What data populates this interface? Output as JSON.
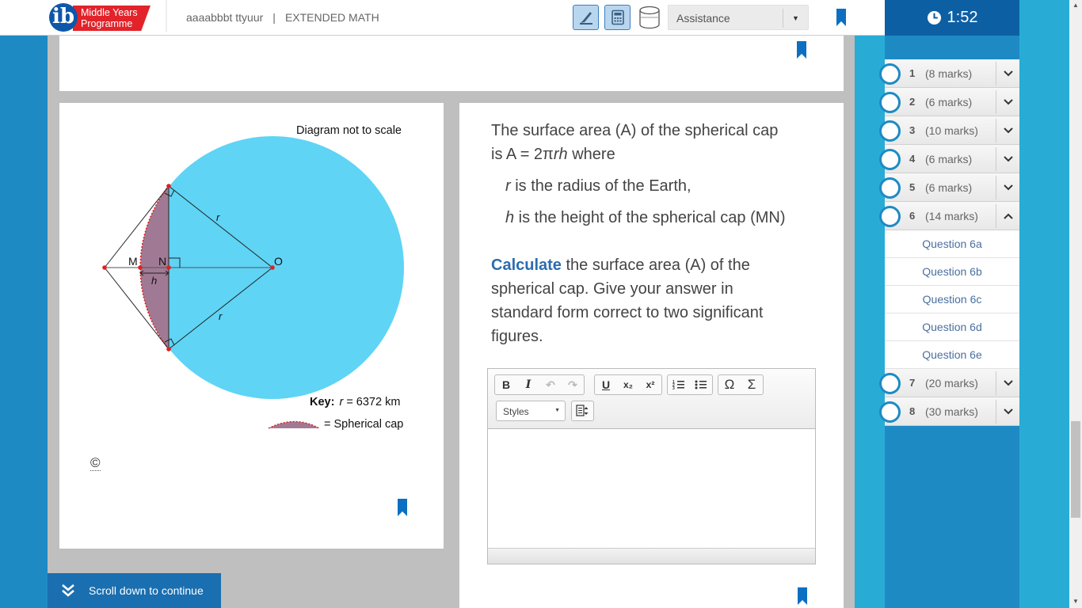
{
  "header": {
    "logo_line1": "Middle Years",
    "logo_line2": "Programme",
    "logo_letters": "ib",
    "candidate": "aaaabbbt ttyuur",
    "separator": "|",
    "subject": "EXTENDED MATH",
    "assistance_label": "Assistance",
    "tools": [
      "highlighter-icon",
      "calculator-icon",
      "cylinder-icon"
    ]
  },
  "timer": {
    "value": "1:52"
  },
  "diagram": {
    "note": "Diagram not to scale",
    "labels": {
      "M": "M",
      "N": "N",
      "O": "O",
      "r_top": "r",
      "r_bottom": "r",
      "h": "h"
    },
    "key_label": "Key:",
    "key_r": "r",
    "key_r_value": "= 6372 km",
    "cap_label": "= Spherical cap",
    "copyright": "©"
  },
  "question": {
    "line1": "The surface area (A) of the spherical cap",
    "line2_pre": "is  A = 2π",
    "line2_rh": "rh",
    "line2_post": " where",
    "line3_r": "r",
    "line3_rest": " is the radius of the Earth,",
    "line4_h": "h",
    "line4_rest": " is the height of the spherical cap (MN)",
    "calc_word": "Calculate",
    "calc_rest": " the surface area (A) of the",
    "line6": "spherical cap. Give your answer in",
    "line7": "standard form correct to two significant",
    "line8": "figures."
  },
  "editor": {
    "bold": "B",
    "italic": "I",
    "underline": "U",
    "subscript": "x₂",
    "superscript": "x²",
    "omega": "Ω",
    "sigma": "Σ",
    "styles_label": "Styles"
  },
  "scroll_button": {
    "label": "Scroll down to continue"
  },
  "questions": [
    {
      "num": "1",
      "marks": "(8 marks)"
    },
    {
      "num": "2",
      "marks": "(6 marks)"
    },
    {
      "num": "3",
      "marks": "(10 marks)"
    },
    {
      "num": "4",
      "marks": "(6 marks)"
    },
    {
      "num": "5",
      "marks": "(6 marks)"
    },
    {
      "num": "6",
      "marks": "(14 marks)",
      "sub": [
        "Question 6a",
        "Question 6b",
        "Question 6c",
        "Question 6d",
        "Question 6e"
      ]
    },
    {
      "num": "7",
      "marks": "(20 marks)"
    },
    {
      "num": "8",
      "marks": "(30 marks)"
    }
  ],
  "colors": {
    "accent": "#1e8ac4",
    "timer_bg": "#0d5fa3",
    "sphere": "#5fd4f5",
    "cap": "#a07a94",
    "brand_red": "#e2232a"
  }
}
